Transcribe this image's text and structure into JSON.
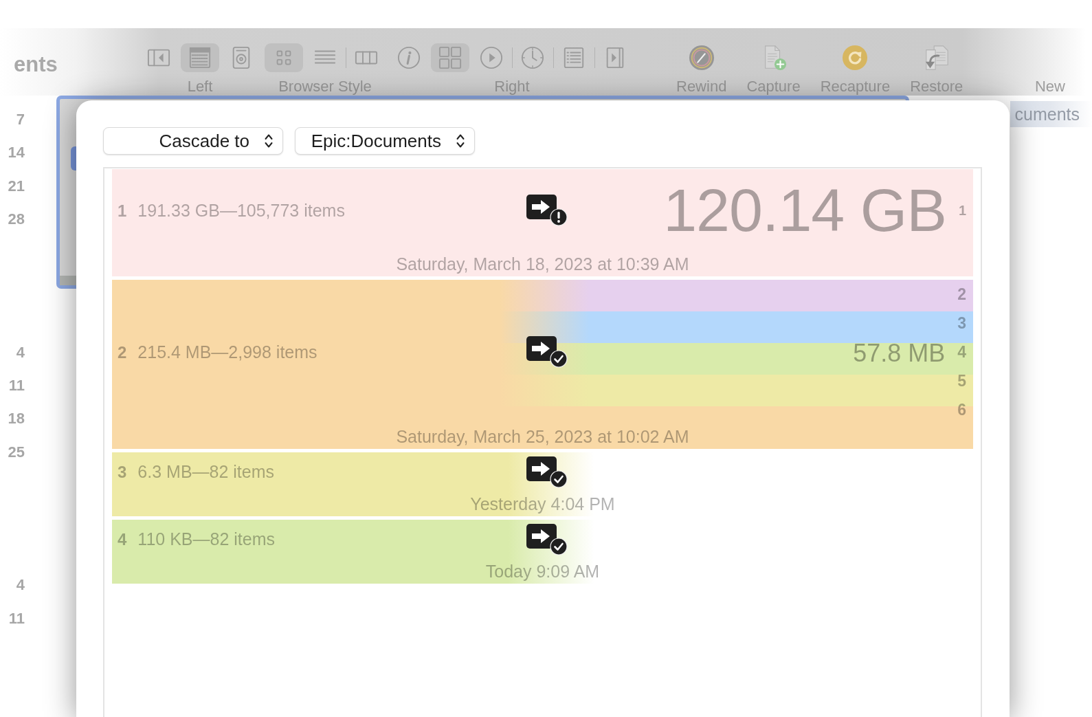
{
  "window": {
    "title": "ents"
  },
  "toolbar": {
    "groups": [
      {
        "label": "Left",
        "items": [
          {
            "kind": "leftpanel",
            "selected": false
          },
          {
            "kind": "calendar",
            "selected": true
          },
          {
            "kind": "disk",
            "selected": false
          }
        ]
      },
      {
        "label": "Browser Style",
        "items": [
          {
            "kind": "smallgrid",
            "selected": true
          },
          {
            "kind": "lines",
            "selected": false
          },
          {
            "kind": "separator"
          },
          {
            "kind": "columns",
            "selected": false
          }
        ]
      },
      {
        "label": "Right",
        "items": [
          {
            "kind": "info",
            "selected": false
          },
          {
            "kind": "grid",
            "selected": true
          },
          {
            "kind": "play",
            "selected": false
          },
          {
            "kind": "separator"
          },
          {
            "kind": "clock",
            "selected": false
          },
          {
            "kind": "separator"
          },
          {
            "kind": "list",
            "selected": false
          },
          {
            "kind": "separator"
          },
          {
            "kind": "rightpanel",
            "selected": false
          }
        ]
      }
    ],
    "actions": [
      {
        "label": "Rewind",
        "kind": "rewind"
      },
      {
        "label": "Capture",
        "kind": "capture"
      },
      {
        "label": "Recapture",
        "kind": "recapture"
      },
      {
        "label": "Restore",
        "kind": "restore"
      },
      {
        "label": "New"
      }
    ]
  },
  "date_column": [
    [
      "7",
      "14",
      "21",
      "28"
    ],
    [
      "4",
      "11",
      "18",
      "25"
    ],
    [
      "4",
      "11"
    ]
  ],
  "path_bar": {
    "text": "cuments"
  },
  "sheet": {
    "popups": [
      {
        "value": "Cascade to"
      },
      {
        "value": "Epic:Documents"
      }
    ],
    "rows": [
      {
        "index": "1",
        "summary": "191.33 GB—105,773 items",
        "warning": true,
        "color": "#fde9e9",
        "kind": "full",
        "total": {
          "size": "120.14 GB",
          "index": "1"
        },
        "date": "Saturday, March 18, 2023 at 10:39 AM"
      },
      {
        "index": "2",
        "summary": "215.4 MB—2,998 items",
        "warning": false,
        "color": "#f9d9a6",
        "kind": "full",
        "breakdown": {
          "size": "57.8 MB",
          "bands": [
            {
              "color": "#e6d0ee"
            },
            {
              "color": "#b4d8fc"
            },
            {
              "color": "#d9ebab"
            },
            {
              "color": "#eeeaa6"
            }
          ],
          "labels": [
            "2",
            "3",
            "4",
            "5",
            "6"
          ]
        },
        "date": "Saturday, March 25, 2023 at 10:02 AM"
      },
      {
        "index": "3",
        "summary": "6.3 MB—82 items",
        "warning": false,
        "color": "#eeeaa6",
        "kind": "partial",
        "date": "Yesterday 4:04 PM"
      },
      {
        "index": "4",
        "summary": "110 KB—82 items",
        "warning": false,
        "color": "#d9ebab",
        "kind": "partial",
        "date": "Today 9:09 AM"
      }
    ]
  }
}
